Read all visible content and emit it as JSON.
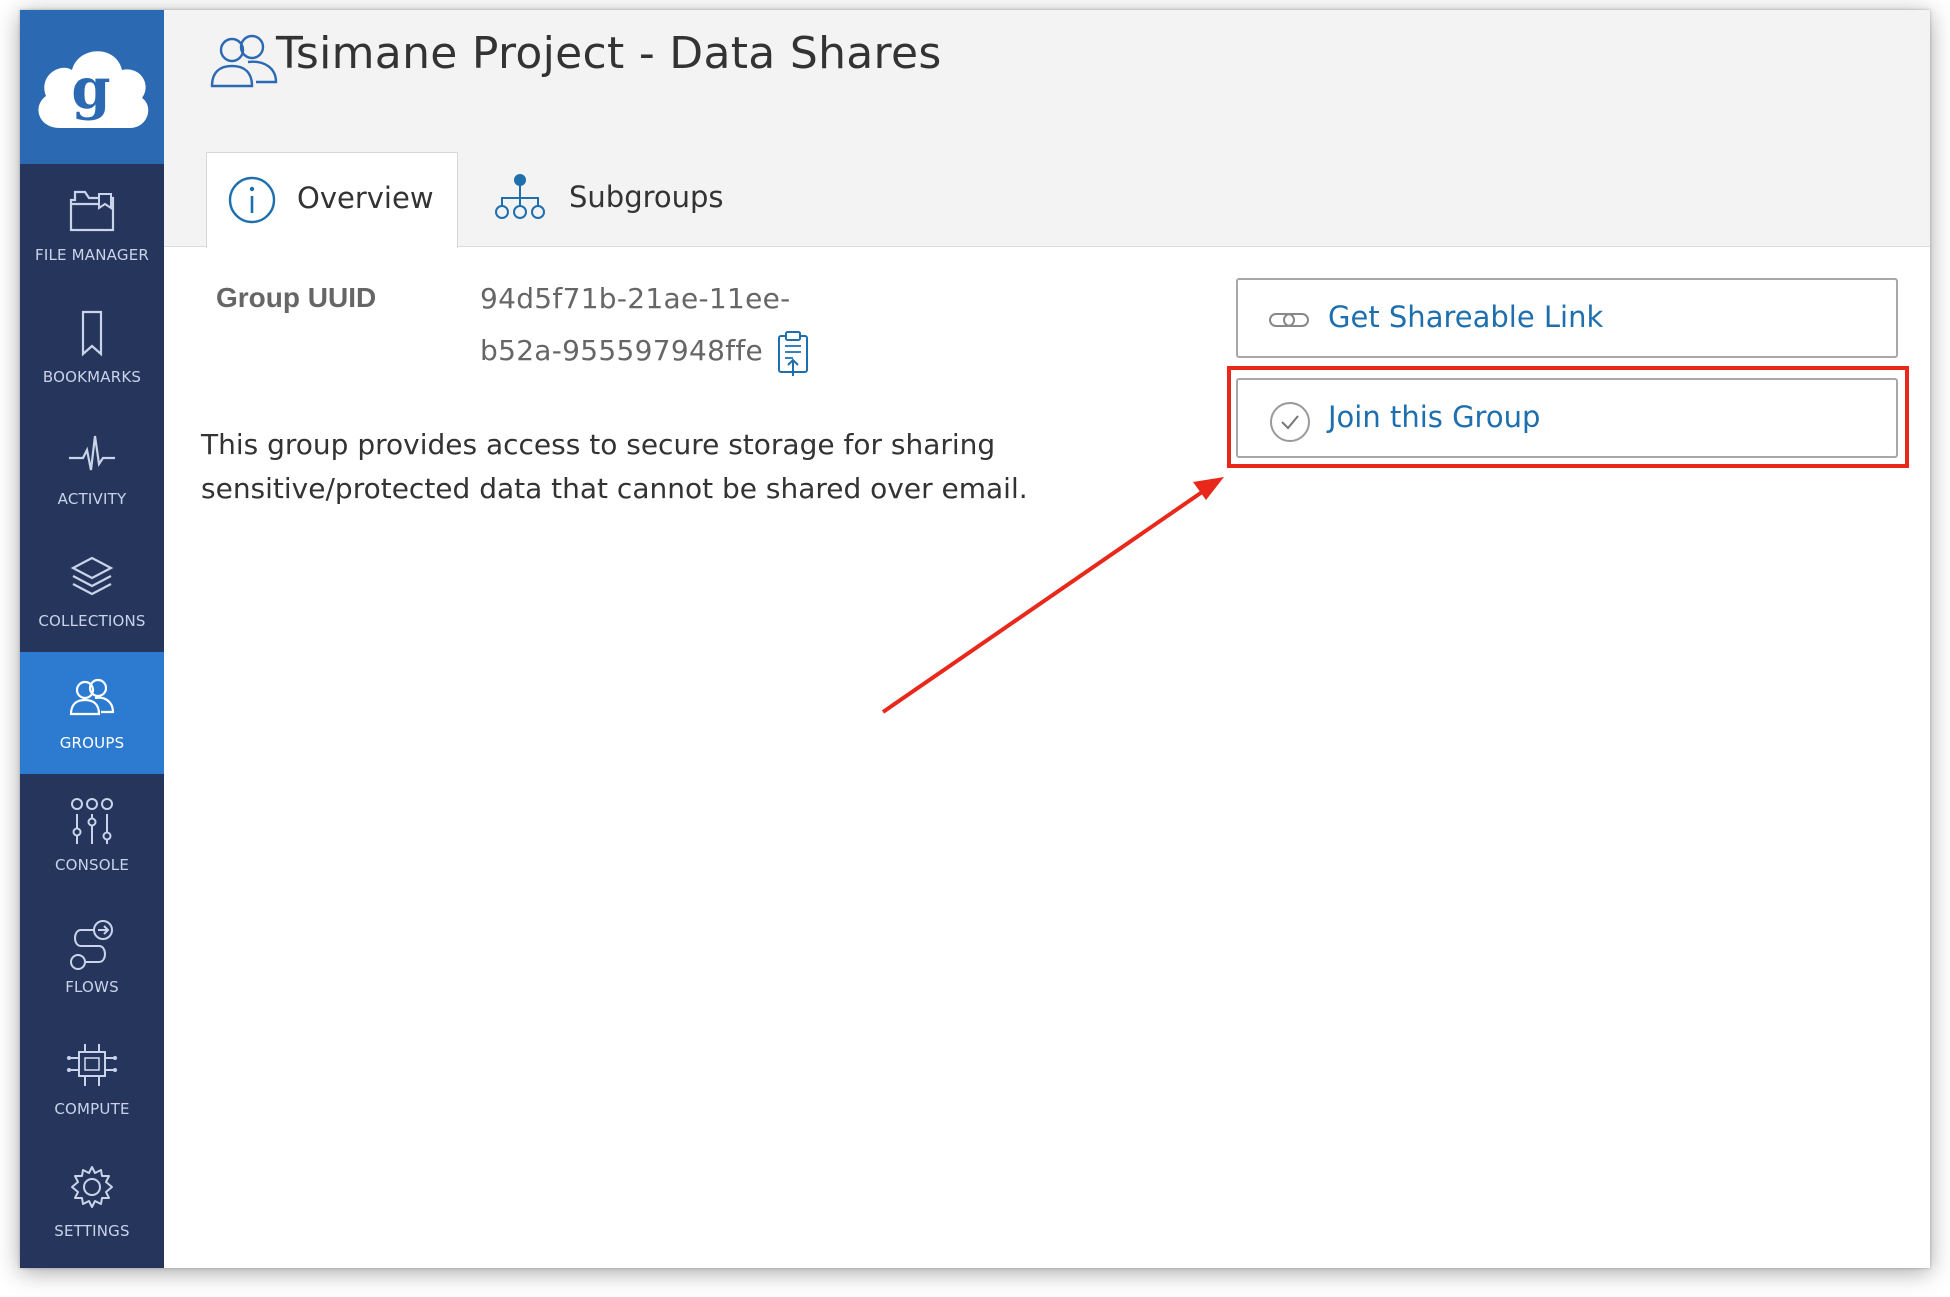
{
  "app": {
    "name": "Globus",
    "logo_letter": "g"
  },
  "sidebar": {
    "items": [
      {
        "label": "FILE MANAGER",
        "icon": "folder-icon",
        "active": false
      },
      {
        "label": "BOOKMARKS",
        "icon": "bookmark-icon",
        "active": false
      },
      {
        "label": "ACTIVITY",
        "icon": "pulse-icon",
        "active": false
      },
      {
        "label": "COLLECTIONS",
        "icon": "layers-icon",
        "active": false
      },
      {
        "label": "GROUPS",
        "icon": "people-icon",
        "active": true
      },
      {
        "label": "CONSOLE",
        "icon": "sliders-icon",
        "active": false
      },
      {
        "label": "FLOWS",
        "icon": "flows-icon",
        "active": false
      },
      {
        "label": "COMPUTE",
        "icon": "compute-icon",
        "active": false
      },
      {
        "label": "SETTINGS",
        "icon": "gear-icon",
        "active": false
      }
    ]
  },
  "header": {
    "title": "Tsimane Project - Data Shares",
    "icon": "people-icon"
  },
  "tabs": [
    {
      "label": "Overview",
      "icon": "info-icon",
      "active": true
    },
    {
      "label": "Subgroups",
      "icon": "hierarchy-icon",
      "active": false
    }
  ],
  "overview": {
    "uuid_label": "Group UUID",
    "uuid_line1": "94d5f71b-21ae-11ee-",
    "uuid_line2": "b52a-955597948ffe",
    "description_line1": "This group provides access to secure storage for sharing",
    "description_line2": "sensitive/protected data that cannot be shared over email."
  },
  "actions": {
    "share_link_label": "Get Shareable Link",
    "join_label": "Join this Group"
  },
  "colors": {
    "sidebar_bg": "#25355c",
    "logo_bg": "#2c69b3",
    "active_nav": "#2c7bd0",
    "link_blue": "#1e6fad",
    "annotation_red": "#e8281b"
  }
}
